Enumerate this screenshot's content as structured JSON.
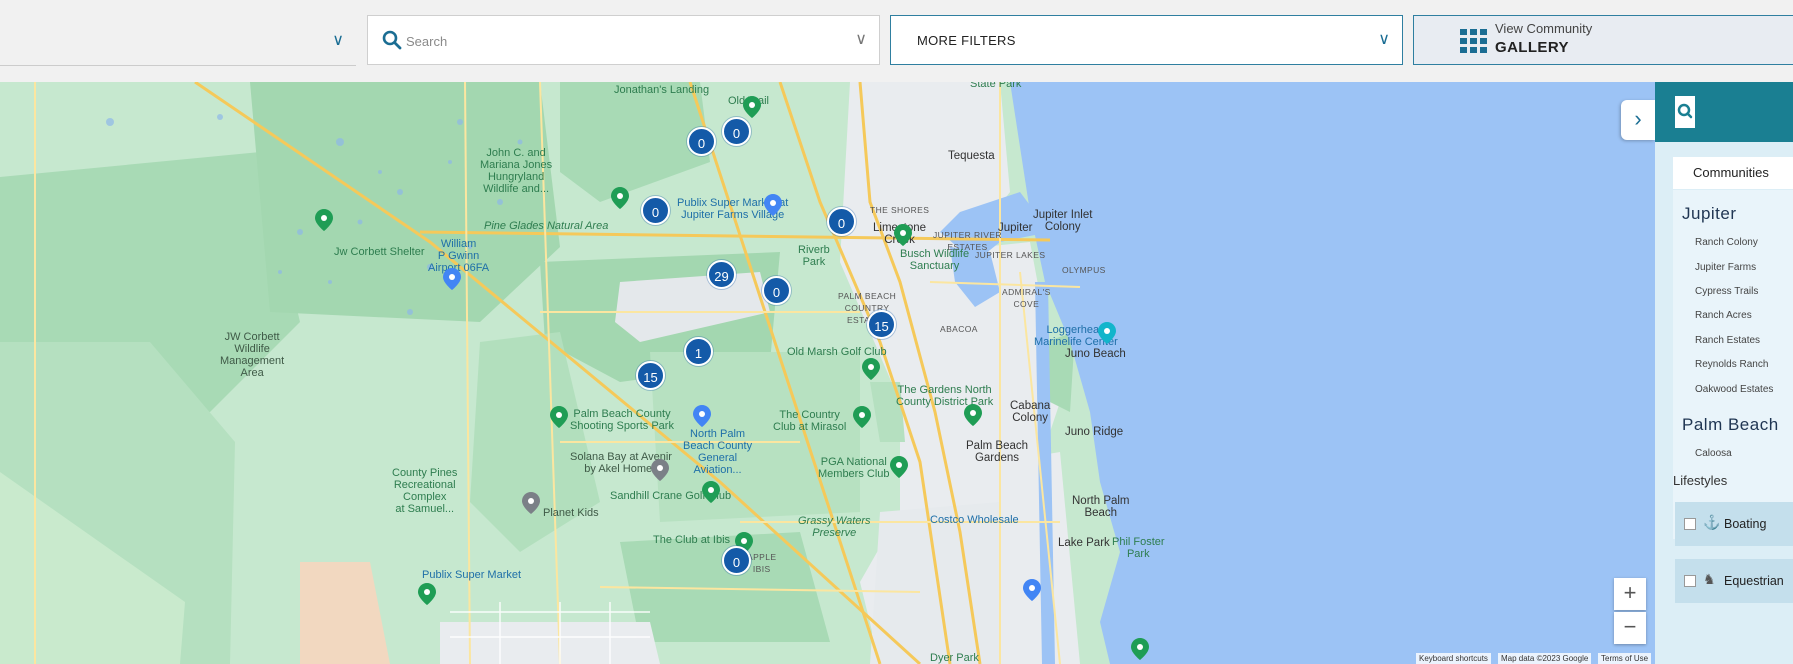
{
  "toolbar": {
    "search_placeholder": "Search",
    "filters_label": "MORE FILTERS",
    "gallery_line1": "View Community",
    "gallery_line2": "GALLERY"
  },
  "map": {
    "labels": {
      "jonathans_landing": "Jonathan's Landing",
      "old_trail": "Old Trail",
      "state_park": "State Park",
      "john_c": "John C. and\nMariana Jones\nHungryland\nWildlife and...",
      "publix_jf": "Publix Super Market at\nJupiter Farms Village",
      "tequesta": "Tequesta",
      "the_shores": "THE SHORES",
      "limestone": "Limestone\nCreek",
      "jupiter_inlet": "Jupiter Inlet\nColony",
      "pine_glades": "Pine Glades Natural Area",
      "jw_corbett_shelter": "Jw Corbett Shelter",
      "riverbend": "Riverb\nPark",
      "jupiter_river": "JUPITER RIVER\nESTATES",
      "jupiter": "Jupiter",
      "jupiter_lakes": "JUPITER LAKES",
      "william_gwinn": "William\nP Gwinn\nAirport 06FA",
      "busch": "Busch Wildlife\nSanctuary",
      "olympus": "OLYMPUS",
      "pbce": "PALM BEACH\nCOUNTRY\nESTATES",
      "admirals": "ADMIRAL'S\nCOVE",
      "abacoa": "ABACOA",
      "loggerhead": "Loggerhead\nMarinelife Center",
      "jw_corbett_wma": "JW Corbett\nWildlife\nManagement\nArea",
      "old_marsh": "Old Marsh Golf Club",
      "juno_beach": "Juno Beach",
      "gardens_north": "The Gardens North\nCounty District Park",
      "cabana": "Cabana\nColony",
      "pbc_shooting": "Palm Beach County\nShooting Sports Park",
      "npbc_airport": "North Palm\nBeach County\nGeneral\nAviation...",
      "country_club": "The Country\nClub at Mirasol",
      "juno_ridge": "Juno Ridge",
      "pbg": "Palm Beach\nGardens",
      "solana": "Solana Bay at Avenir\nby Akel Homes",
      "pga": "PGA National\nMembers Club",
      "county_pines": "County Pines\nRecreational\nComplex\nat Samuel...",
      "sandhill": "Sandhill Crane Golf Club",
      "planet_kids": "Planet Kids",
      "north_palm": "North Palm\nBeach",
      "costco": "Costco Wholesale",
      "grassy": "Grassy Waters\nPreserve",
      "club_ibis": "The Club at Ibis",
      "apple_ibis": "APPLE\nIBIS",
      "lake_park": "Lake Park",
      "phil_foster": "Phil Foster\nPark",
      "publix_bottom": "Publix Super Market",
      "dyer_park": "Dyer Park"
    },
    "clusters": [
      "0",
      "0",
      "0",
      "0",
      "29",
      "0",
      "15",
      "1",
      "15",
      "0"
    ],
    "attribution": {
      "shortcuts": "Keyboard shortcuts",
      "mapdata": "Map data ©2023 Google",
      "terms": "Terms of Use"
    },
    "colors": {
      "water": "#9cc3f5",
      "land": "#c6e8cf",
      "park": "#a8dab5",
      "urban": "#e9ecef",
      "road": "#f7d27a",
      "cluster": "#145aa8"
    }
  },
  "panel": {
    "tab_label": "Communities",
    "jupiter_heading": "Jupiter",
    "jupiter_items": [
      "Ranch Colony",
      "Jupiter Farms",
      "Cypress Trails",
      "Ranch Acres",
      "Ranch Estates",
      "Reynolds Ranch",
      "Oakwood Estates"
    ],
    "palm_beach_heading": "Palm Beach",
    "palm_beach_partial": "Caloosa",
    "lifestyles_label": "Lifestyles",
    "options": [
      "Boating",
      "Equestrian"
    ]
  }
}
